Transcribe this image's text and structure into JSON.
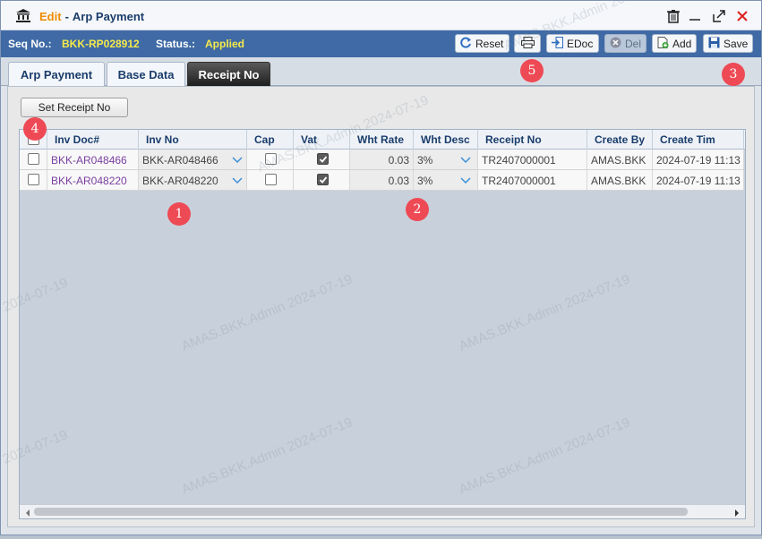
{
  "window": {
    "mode": "Edit",
    "separator": "-",
    "title": "Arp Payment"
  },
  "infobar": {
    "seq_label": "Seq No.:",
    "seq_value": "BKK-RP028912",
    "status_label": "Status.:",
    "status_value": "Applied"
  },
  "toolbar": {
    "reset_label": "Reset",
    "edoc_label": "EDoc",
    "del_label": "Del",
    "add_label": "Add",
    "save_label": "Save"
  },
  "tabs": [
    {
      "label": "Arp Payment",
      "active": false
    },
    {
      "label": "Base Data",
      "active": false
    },
    {
      "label": "Receipt No",
      "active": true
    }
  ],
  "content": {
    "set_receipt_label": "Set Receipt No"
  },
  "grid": {
    "columns": [
      "Inv Doc#",
      "Inv No",
      "Cap",
      "Vat",
      "Wht Rate",
      "Wht Desc",
      "Receipt No",
      "Create By",
      "Create Tim"
    ],
    "rows": [
      {
        "selected": false,
        "inv_doc": "BKK-AR048466",
        "inv_no": "BKK-AR048466",
        "cap": false,
        "vat": true,
        "wht_rate": "0.03",
        "wht_desc": "3%",
        "receipt_no": "TR2407000001",
        "create_by": "AMAS.BKK",
        "create_time": "2024-07-19 11:13"
      },
      {
        "selected": false,
        "inv_doc": "BKK-AR048220",
        "inv_no": "BKK-AR048220",
        "cap": false,
        "vat": true,
        "wht_rate": "0.03",
        "wht_desc": "3%",
        "receipt_no": "TR2407000001",
        "create_by": "AMAS.BKK",
        "create_time": "2024-07-19 11:13"
      }
    ]
  },
  "badges": [
    "1",
    "2",
    "3",
    "4",
    "5"
  ],
  "watermark": {
    "text_user": "AMAS.BKK.Admin 2024-07-19",
    "text_date": "2024-07-19"
  },
  "colors": {
    "infobar_bg": "#3f6aa5",
    "status_value": "#f5e94a",
    "title_mode": "#f08c00",
    "badge": "#ee4a55",
    "link": "#7a3fa0"
  },
  "icons": [
    "bank-icon",
    "trash-icon",
    "minimize-icon",
    "maximize-icon",
    "close-icon",
    "reset-icon",
    "print-icon",
    "edoc-icon",
    "delete-icon",
    "add-icon",
    "save-icon",
    "chevron-down-icon"
  ]
}
